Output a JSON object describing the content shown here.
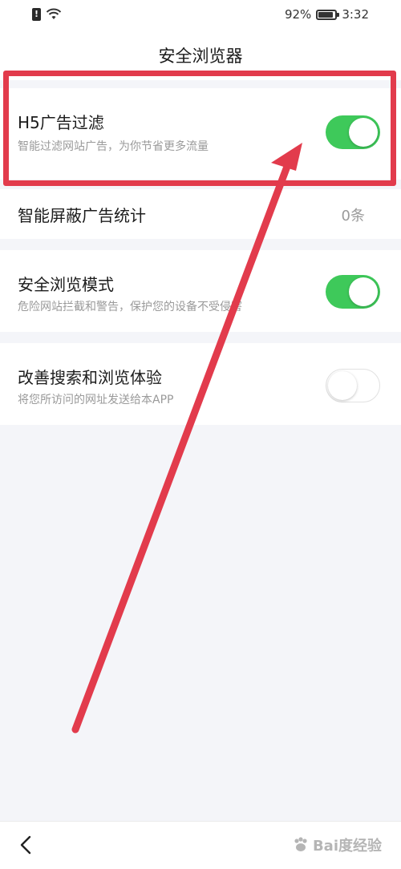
{
  "status": {
    "battery": "92%",
    "time": "3:32",
    "battery_level": 0.92
  },
  "header": {
    "title": "安全浏览器"
  },
  "settings": [
    {
      "title": "H5广告过滤",
      "subtitle": "智能过滤网站广告，为你节省更多流量",
      "toggle": true
    },
    {
      "title": "智能屏蔽广告统计",
      "value": "0条"
    },
    {
      "title": "安全浏览模式",
      "subtitle": "危险网站拦截和警告，保护您的设备不受侵害",
      "toggle": true
    },
    {
      "title": "改善搜索和浏览体验",
      "subtitle": "将您所访问的网址发送给本APP",
      "toggle": false
    }
  ],
  "watermark": "Bai度经验",
  "colors": {
    "toggle_on": "#3ec95a",
    "annotation_red": "#e23b4c",
    "background": "#f4f5f9"
  },
  "icons": {
    "back": "chevron-left-icon",
    "wifi": "wifi-icon",
    "battery": "battery-icon",
    "alert": "alert-icon"
  }
}
